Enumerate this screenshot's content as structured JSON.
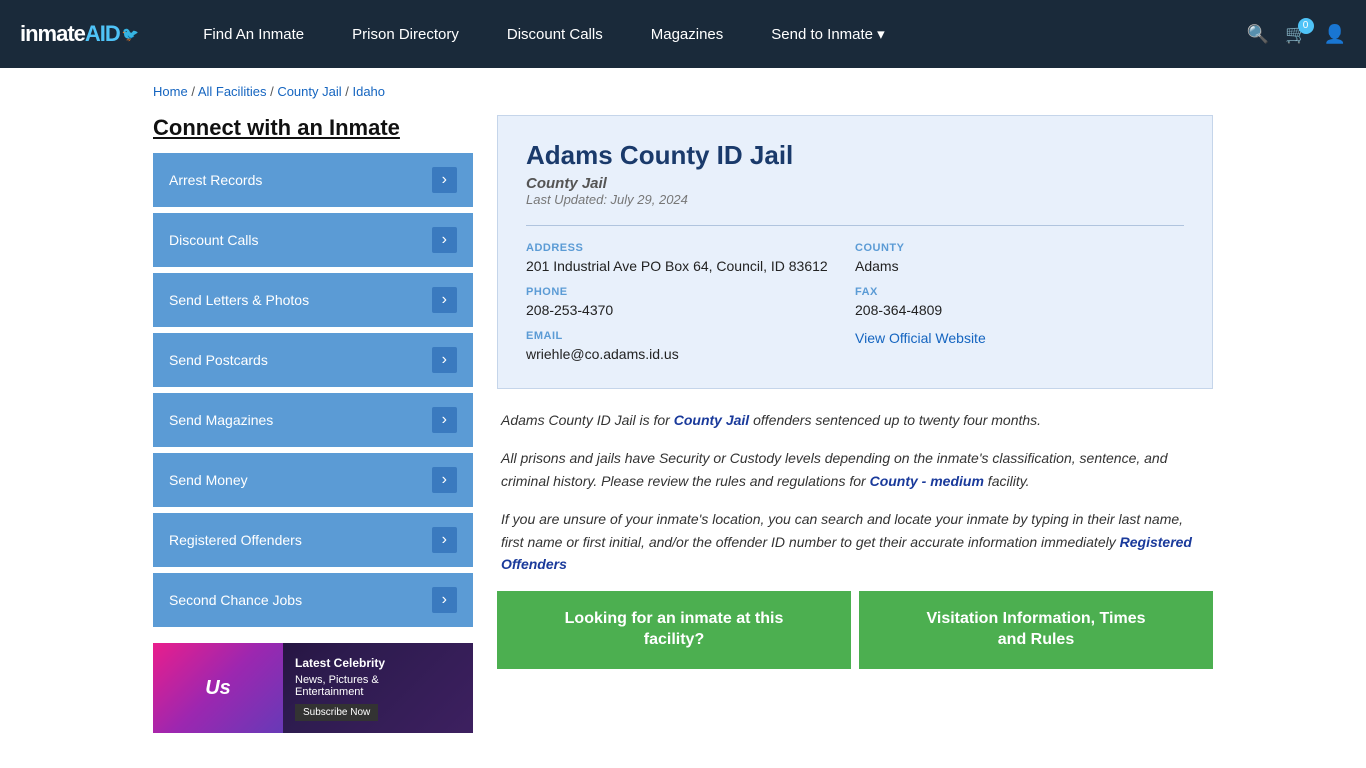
{
  "nav": {
    "logo": "inmate",
    "logo_aid": "AID",
    "links": [
      {
        "label": "Find An Inmate",
        "name": "find-inmate"
      },
      {
        "label": "Prison Directory",
        "name": "prison-directory"
      },
      {
        "label": "Discount Calls",
        "name": "discount-calls"
      },
      {
        "label": "Magazines",
        "name": "magazines"
      },
      {
        "label": "Send to Inmate ▾",
        "name": "send-to-inmate"
      }
    ],
    "cart_count": "0"
  },
  "breadcrumb": {
    "home": "Home",
    "all_facilities": "All Facilities",
    "county_jail": "County Jail",
    "state": "Idaho",
    "sep": " / "
  },
  "sidebar": {
    "title": "Connect with an Inmate",
    "buttons": [
      "Arrest Records",
      "Discount Calls",
      "Send Letters & Photos",
      "Send Postcards",
      "Send Magazines",
      "Send Money",
      "Registered Offenders",
      "Second Chance Jobs"
    ],
    "ad": {
      "brand": "Us",
      "line1": "Latest Celebrity",
      "line2": "News, Pictures &",
      "line3": "Entertainment",
      "cta": "Subscribe Now"
    }
  },
  "facility": {
    "title": "Adams County ID Jail",
    "type": "County Jail",
    "updated": "Last Updated: July 29, 2024",
    "address_label": "ADDRESS",
    "address": "201 Industrial Ave PO Box 64, Council, ID 83612",
    "county_label": "COUNTY",
    "county": "Adams",
    "phone_label": "PHONE",
    "phone": "208-253-4370",
    "fax_label": "FAX",
    "fax": "208-364-4809",
    "email_label": "EMAIL",
    "email": "wriehle@co.adams.id.us",
    "website_label": "View Official Website"
  },
  "description": {
    "para1_before": "Adams County ID Jail is for ",
    "para1_link": "County Jail",
    "para1_after": " offenders sentenced up to twenty four months.",
    "para2_before": "All prisons and jails have Security or Custody levels depending on the inmate's classification, sentence, and criminal history. Please review the rules and regulations for ",
    "para2_link": "County - medium",
    "para2_after": " facility.",
    "para3_before": "If you are unsure of your inmate's location, you can search and locate your inmate by typing in their last name, first name or first initial, and/or the offender ID number to get their accurate information immediately ",
    "para3_link": "Registered Offenders"
  },
  "buttons": {
    "btn1_line1": "Looking for an inmate at this",
    "btn1_line2": "facility?",
    "btn2_line1": "Visitation Information, Times",
    "btn2_line2": "and Rules"
  }
}
